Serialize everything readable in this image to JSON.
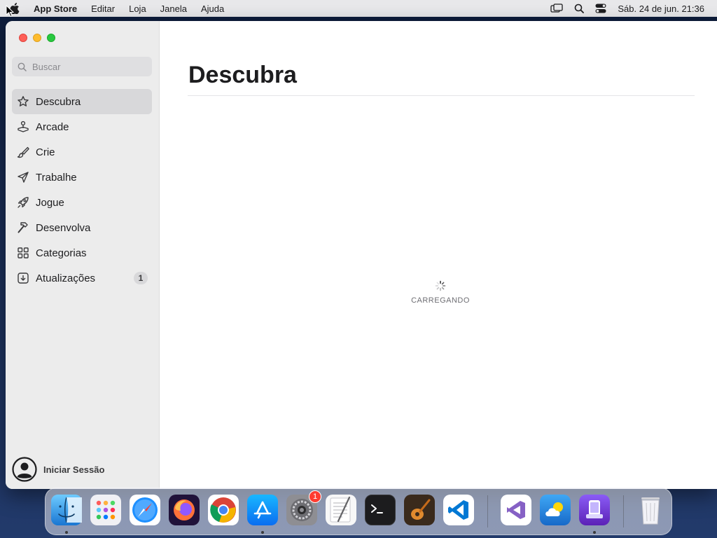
{
  "menubar": {
    "app_name": "App Store",
    "menus": [
      "Editar",
      "Loja",
      "Janela",
      "Ajuda"
    ],
    "clock": "Sáb. 24 de jun.  21:36"
  },
  "sidebar": {
    "search_placeholder": "Buscar",
    "items": [
      {
        "label": "Descubra",
        "icon": "star-icon"
      },
      {
        "label": "Arcade",
        "icon": "joystick-icon"
      },
      {
        "label": "Crie",
        "icon": "brush-icon"
      },
      {
        "label": "Trabalhe",
        "icon": "paper-plane-icon"
      },
      {
        "label": "Jogue",
        "icon": "rocket-icon"
      },
      {
        "label": "Desenvolva",
        "icon": "hammer-icon"
      },
      {
        "label": "Categorias",
        "icon": "grid-icon"
      },
      {
        "label": "Atualizações",
        "icon": "download-icon",
        "badge": "1"
      }
    ],
    "signin_label": "Iniciar Sessão"
  },
  "main": {
    "title": "Descubra",
    "loading_text": "CARREGANDO"
  },
  "dock": {
    "apps": [
      "Finder",
      "Launchpad",
      "Safari",
      "Firefox",
      "Chrome",
      "App Store",
      "System Settings",
      "TextEdit",
      "Terminal",
      "GarageBand",
      "VS Code",
      "Visual Studio",
      "Weather",
      "Simulator",
      "Trash"
    ],
    "settings_badge": "1"
  },
  "colors": {
    "accent_blue": "#1f7bf6",
    "sidebar_bg": "#ececec",
    "badge_red": "#ff3b30"
  }
}
